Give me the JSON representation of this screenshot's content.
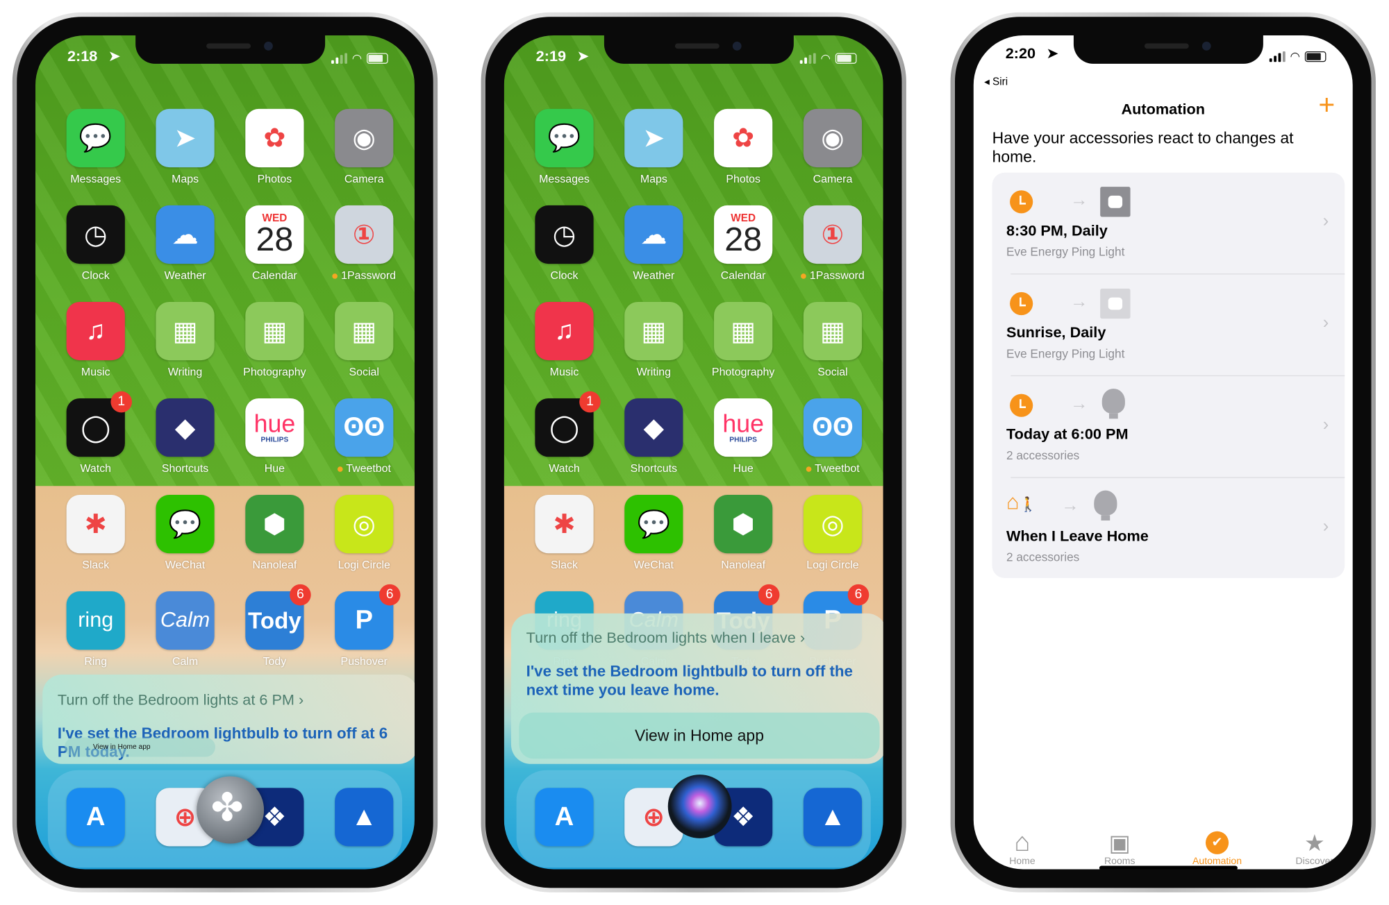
{
  "home_screen": {
    "apps": [
      {
        "name": "Messages",
        "color": "#35c94b",
        "glyph": "💬"
      },
      {
        "name": "Maps",
        "color": "#7fc7e8",
        "glyph": "➤"
      },
      {
        "name": "Photos",
        "color": "#ffffff",
        "glyph": "✿"
      },
      {
        "name": "Camera",
        "color": "#8a8a8e",
        "glyph": "◉"
      },
      {
        "name": "Clock",
        "color": "#111111",
        "glyph": "◷"
      },
      {
        "name": "Weather",
        "color": "#3a8ee6",
        "glyph": "☁"
      },
      {
        "name": "Calendar",
        "color": "#ffffff",
        "glyph": "28",
        "sub": "WED"
      },
      {
        "name": "1Password",
        "color": "#cfd6de",
        "glyph": "①",
        "dot": true
      },
      {
        "name": "Music",
        "color": "#f0344b",
        "glyph": "♫"
      },
      {
        "name": "Writing",
        "color": "#8cc95b",
        "glyph": "▦"
      },
      {
        "name": "Photography",
        "color": "#8cc95b",
        "glyph": "▦"
      },
      {
        "name": "Social",
        "color": "#8cc95b",
        "glyph": "▦"
      },
      {
        "name": "Watch",
        "color": "#111111",
        "glyph": "◯",
        "badge": "1"
      },
      {
        "name": "Shortcuts",
        "color": "#2a2f6e",
        "glyph": "◆"
      },
      {
        "name": "Hue",
        "color": "#ffffff",
        "glyph": "hue",
        "sub2": "PHILIPS"
      },
      {
        "name": "Tweetbot",
        "color": "#4aa3ea",
        "glyph": "ʘʘ",
        "dot": true
      },
      {
        "name": "Slack",
        "color": "#f4f4f4",
        "glyph": "✱"
      },
      {
        "name": "WeChat",
        "color": "#2dc100",
        "glyph": "💬"
      },
      {
        "name": "Nanoleaf",
        "color": "#3a9a3a",
        "glyph": "⬢"
      },
      {
        "name": "Logi Circle",
        "color": "#c8e61a",
        "glyph": "◎"
      },
      {
        "name": "Ring",
        "color": "#1fa9c9",
        "glyph": "ring"
      },
      {
        "name": "Calm",
        "color": "#4a8ad8",
        "glyph": "Calm"
      },
      {
        "name": "Tody",
        "color": "#2d7fd6",
        "glyph": "Tody",
        "badge": "6"
      },
      {
        "name": "Pushover",
        "color": "#2a8be6",
        "glyph": "P",
        "badge": "6"
      }
    ],
    "dock": [
      {
        "name": "App Store",
        "color": "#1a8cf0",
        "glyph": "A"
      },
      {
        "name": "Safari",
        "color": "#e8eef5",
        "glyph": "⊕"
      },
      {
        "name": "Dropbox",
        "color": "#0d2b7a",
        "glyph": "❖"
      },
      {
        "name": "Spark",
        "color": "#1567d3",
        "glyph": "▲"
      }
    ]
  },
  "phone1": {
    "time": "2:18",
    "siri": {
      "query": "Turn off the Bedroom lights at 6 PM",
      "response": "I've set the Bedroom lightbulb to turn off at 6 PM today.",
      "overlay_button": "View in Home app"
    }
  },
  "phone2": {
    "time": "2:19",
    "siri": {
      "query": "Turn off the Bedroom lights when I leave",
      "response": "I've set the Bedroom lightbulb to turn off the next time you leave home.",
      "button": "View in Home app"
    }
  },
  "phone3": {
    "time": "2:20",
    "back": "Siri",
    "title": "Automation",
    "add": "+",
    "description": "Have your accessories react to changes at home.",
    "accent": "#f7931a",
    "automations": [
      {
        "title": "8:30 PM, Daily",
        "subtitle": "Eve Energy Ping Light",
        "trigger": "clock-icon",
        "target": "outlet-icon"
      },
      {
        "title": "Sunrise, Daily",
        "subtitle": "Eve Energy Ping Light",
        "trigger": "clock-icon",
        "target": "outlet-icon"
      },
      {
        "title": "Today at 6:00 PM",
        "subtitle": "2 accessories",
        "trigger": "clock-icon",
        "target": "lightbulb-icon"
      },
      {
        "title": "When I Leave Home",
        "subtitle": "2 accessories",
        "trigger": "leave-home-icon",
        "target": "lightbulb-icon"
      }
    ],
    "tabs": [
      {
        "label": "Home",
        "icon": "house-icon",
        "active": false
      },
      {
        "label": "Rooms",
        "icon": "rooms-icon",
        "active": false
      },
      {
        "label": "Automation",
        "icon": "automation-icon",
        "active": true
      },
      {
        "label": "Discover",
        "icon": "star-icon",
        "active": false
      }
    ]
  }
}
